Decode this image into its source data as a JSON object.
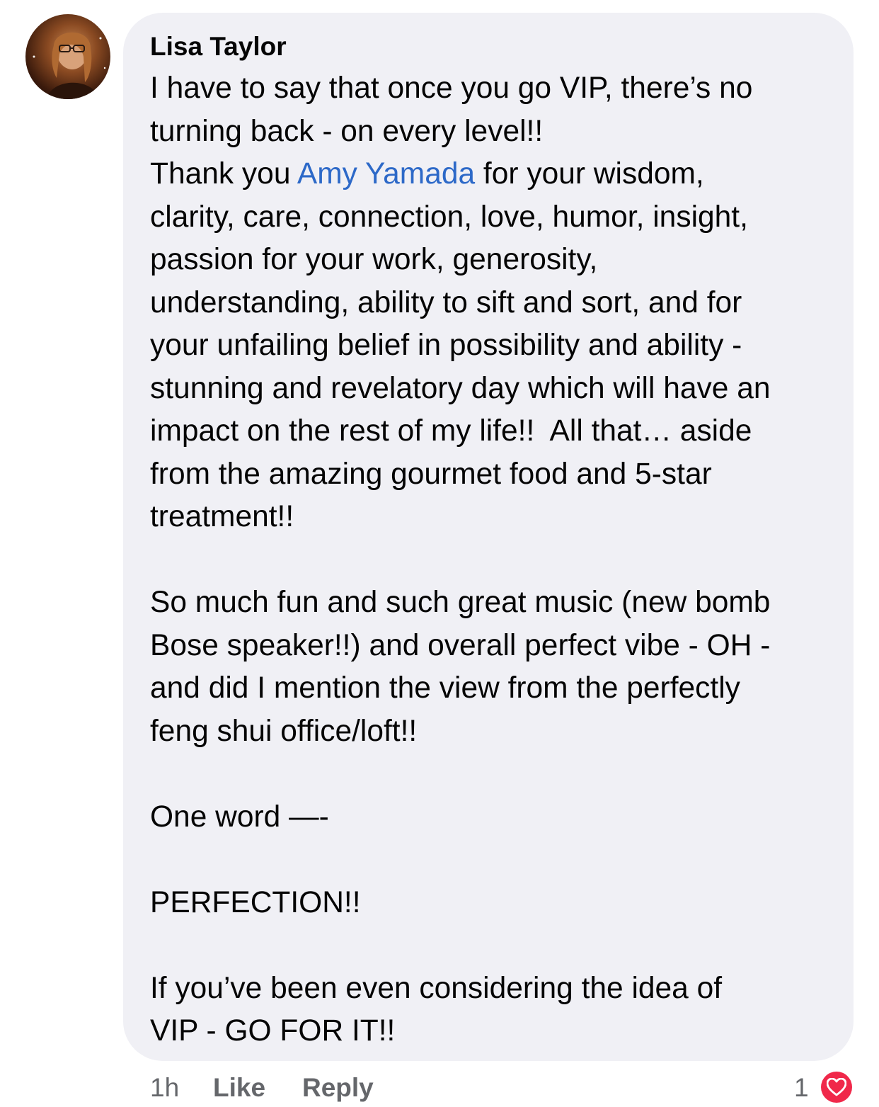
{
  "comment": {
    "author": "Lisa Taylor",
    "lines": [
      {
        "before": "I have to say that once you go VIP, there’s no"
      },
      {
        "before": "turning back - on every level!!"
      },
      {
        "before": "Thank you ",
        "mention": "Amy Yamada",
        "after": " for your wisdom,"
      },
      {
        "before": "clarity, care, connection, love, humor, insight,"
      },
      {
        "before": "passion for your work, generosity,"
      },
      {
        "before": "understanding, ability to sift and sort, and for"
      },
      {
        "before": "your unfailing belief in possibility and ability -"
      },
      {
        "before": "stunning and revelatory day which will have an"
      },
      {
        "before": "impact on the rest of my life!!  All that… aside"
      },
      {
        "before": "from the amazing gourmet food and 5-star"
      },
      {
        "before": "treatment!!"
      },
      {
        "before": ""
      },
      {
        "before": "So much fun and such great music (new bomb"
      },
      {
        "before": "Bose speaker!!) and overall perfect vibe - OH -"
      },
      {
        "before": "and did I mention the view from the perfectly"
      },
      {
        "before": "feng shui office/loft!!"
      },
      {
        "before": ""
      },
      {
        "before": "One word —-"
      },
      {
        "before": ""
      },
      {
        "before": "PERFECTION!!"
      },
      {
        "before": ""
      },
      {
        "before": "If you’ve been even considering the idea of"
      },
      {
        "before": "VIP - GO FOR IT!!"
      }
    ]
  },
  "footer": {
    "time": "1h",
    "like_label": "Like",
    "reply_label": "Reply",
    "reaction_count": "1"
  },
  "icons": {
    "avatar": "profile-photo",
    "reaction": "heart-icon"
  },
  "colors": {
    "bubble": "#f0f0f5",
    "mention": "#2d69c8",
    "meta": "#65676b",
    "heart": "#f0284a"
  }
}
